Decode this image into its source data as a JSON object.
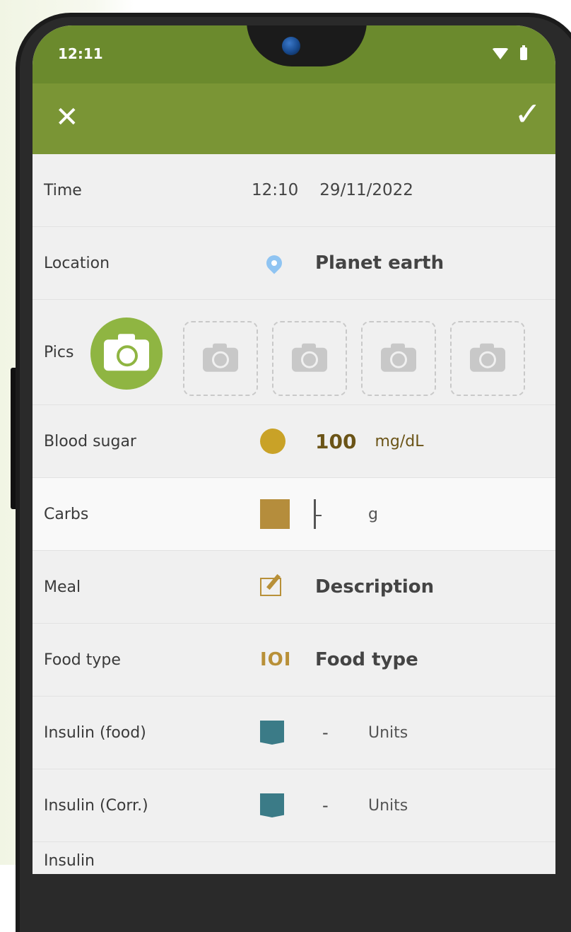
{
  "status": {
    "time": "12:11"
  },
  "toolbar": {
    "close_label": "✕",
    "confirm_label": "✓"
  },
  "rows": {
    "time": {
      "label": "Time",
      "time": "12:10",
      "date": "29/11/2022"
    },
    "location": {
      "label": "Location",
      "value": "Planet earth"
    },
    "pics": {
      "label": "Pics"
    },
    "blood_sugar": {
      "label": "Blood sugar",
      "value": "100",
      "unit": "mg/dL",
      "color": "#c9a227"
    },
    "carbs": {
      "label": "Carbs",
      "unit": "g",
      "color": "#b58d3c"
    },
    "meal": {
      "label": "Meal",
      "value": "Description"
    },
    "food_type": {
      "label": "Food type",
      "value": "Food type",
      "icon_text": "IOI"
    },
    "insulin_food": {
      "label": "Insulin (food)",
      "value": "-",
      "unit": "Units",
      "color": "#3b7b87"
    },
    "insulin_corr": {
      "label": "Insulin (Corr.)",
      "value": "-",
      "unit": "Units",
      "color": "#3b7b87"
    },
    "insulin_more": {
      "label": "Insulin"
    }
  },
  "colors": {
    "statusbar": "#6b8a2d",
    "toolbar": "#7a9535",
    "camera_button": "#8fb542"
  },
  "icons": [
    "close-icon",
    "check-icon",
    "location-pin-icon",
    "camera-icon",
    "meal-edit-icon",
    "utensils-icon",
    "insulin-pen-icon"
  ]
}
